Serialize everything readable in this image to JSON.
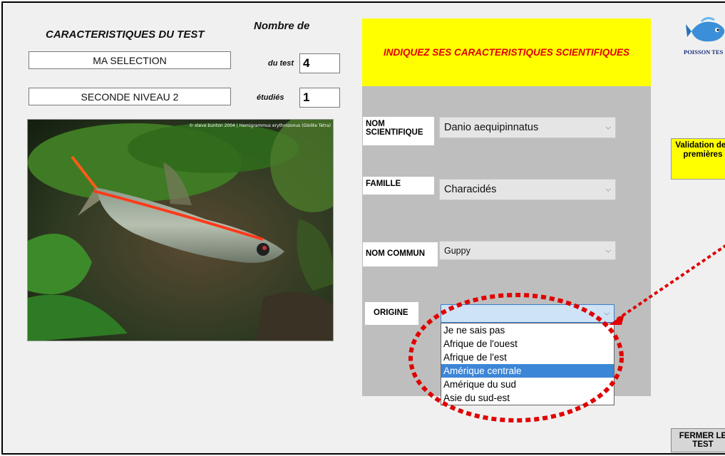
{
  "form": {
    "title": "CARACTERISTIQUES DU TEST",
    "nombre_label": "Nombre  de",
    "selection_value": "MA SELECTION",
    "level_value": "SECONDE NIVEAU 2",
    "du_test_label": "du test",
    "du_test_value": "4",
    "etudies_label": "étudiés",
    "etudies_value": "1",
    "photo_credit": "© steve bunton 2004 | Hemigrammus erythrozonus (Glolite Tetra)"
  },
  "panel": {
    "header": "INDIQUEZ SES CARACTERISTIQUES SCIENTIFIQUES",
    "nom_scientifique_label": "NOM\nSCIENTIFIQUE",
    "nom_scientifique_value": "Danio aequipinnatus",
    "famille_label": "FAMILLE",
    "famille_value": "Characidés",
    "nom_commun_label": "NOM COMMUN",
    "nom_commun_value": "Guppy",
    "origine_label": "ORIGINE",
    "origine_value": "",
    "origine_options": [
      "Je ne sais pas",
      "Afrique de l'ouest",
      "Afrique de l'est",
      "Amérique centrale",
      "Amérique du sud",
      "Asie du sud-est"
    ],
    "origine_highlighted": "Amérique centrale"
  },
  "right": {
    "logo_text": "POISSON TES",
    "validation_button": "Validation des premières",
    "close_button": "FERMER LE TEST"
  },
  "colors": {
    "header_bg": "#ffff00",
    "header_text": "#e00000",
    "highlight": "#3c86d8",
    "annotation": "#e00000"
  }
}
